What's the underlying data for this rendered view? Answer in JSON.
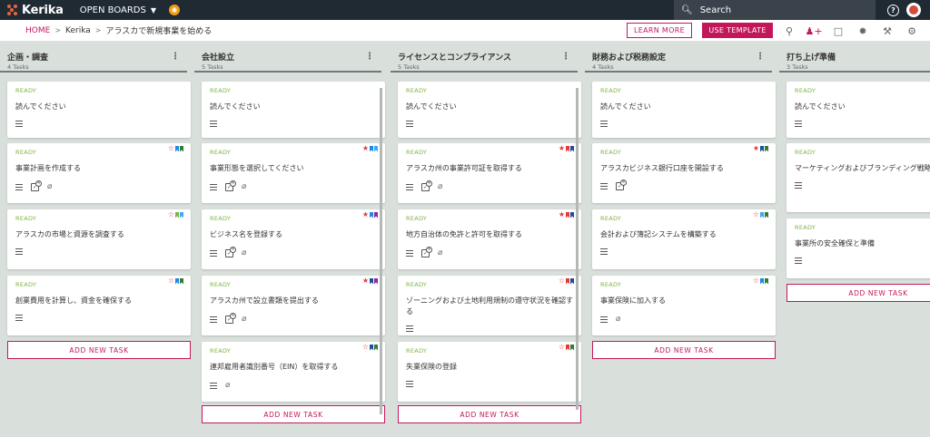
{
  "topbar": {
    "app_name": "Kerika",
    "open_boards": "OPEN BOARDS",
    "search_placeholder": "Search"
  },
  "breadcrumb": {
    "home": "HOME",
    "account": "Kerika",
    "board": "アラスカで新規事業を始める"
  },
  "actions": {
    "learn_more": "LEARN MORE",
    "use_template": "USE TEMPLATE"
  },
  "colors": {
    "accent": "#c2185b",
    "ready": "#7cb342",
    "flag_blue": "#1e88e5",
    "flag_navy": "#1a4fa0",
    "flag_green": "#2e7d32",
    "flag_purple": "#8e24aa",
    "flag_red": "#e53935",
    "flag_lightblue": "#42a5f5",
    "flag_lime": "#7cb342"
  },
  "columns": [
    {
      "title": "企画・調査",
      "count": "4 Tasks",
      "add_task": "ADD NEW TASK",
      "cards": [
        {
          "status": "READY",
          "title": "読んでください",
          "icons": [
            "lines"
          ],
          "markers": []
        },
        {
          "status": "READY",
          "title": "事業計画を作成する",
          "icons": [
            "lines",
            "check",
            "clip"
          ],
          "check_num": "4",
          "markers": [
            "star-outline",
            "flag_blue",
            "flag_green"
          ]
        },
        {
          "status": "READY",
          "title": "アラスカの市場と資源を調査する",
          "icons": [
            "lines"
          ],
          "markers": [
            "star-outline",
            "flag_lime",
            "flag_lightblue"
          ]
        },
        {
          "status": "READY",
          "title": "創業費用を計算し、資金を確保する",
          "icons": [
            "lines"
          ],
          "markers": [
            "star-outline",
            "flag_blue",
            "flag_green"
          ]
        }
      ]
    },
    {
      "title": "会社設立",
      "count": "5 Tasks",
      "add_task": "ADD NEW TASK",
      "cards": [
        {
          "status": "READY",
          "title": "読んでください",
          "icons": [
            "lines"
          ],
          "markers": []
        },
        {
          "status": "READY",
          "title": "事業形態を選択してください",
          "icons": [
            "lines",
            "check",
            "clip"
          ],
          "check_num": "4",
          "markers": [
            "star",
            "flag_blue",
            "flag_lightblue"
          ]
        },
        {
          "status": "READY",
          "title": "ビジネス名を登録する",
          "icons": [
            "lines",
            "check",
            "clip"
          ],
          "check_num": "4",
          "markers": [
            "star",
            "flag_blue",
            "flag_purple"
          ]
        },
        {
          "status": "READY",
          "title": "アラスカ州で設立書類を提出する",
          "icons": [
            "lines",
            "check",
            "clip"
          ],
          "check_num": "4",
          "markers": [
            "star",
            "flag_navy",
            "flag_purple"
          ]
        },
        {
          "status": "READY",
          "title": "連邦雇用者識別番号（EIN）を取得する",
          "icons": [
            "lines",
            "clip"
          ],
          "markers": [
            "star-outline",
            "flag_navy",
            "flag_green"
          ]
        }
      ]
    },
    {
      "title": "ライセンスとコンプライアンス",
      "count": "5 Tasks",
      "add_task": "ADD NEW TASK",
      "cards": [
        {
          "status": "READY",
          "title": "読んでください",
          "icons": [
            "lines"
          ],
          "markers": []
        },
        {
          "status": "READY",
          "title": "アラスカ州の事業許可証を取得する",
          "icons": [
            "lines",
            "check",
            "clip"
          ],
          "check_num": "4",
          "markers": [
            "star",
            "flag_red",
            "flag_navy"
          ]
        },
        {
          "status": "READY",
          "title": "地方自治体の免許と許可を取得する",
          "icons": [
            "lines",
            "check",
            "clip"
          ],
          "check_num": "4",
          "markers": [
            "star",
            "flag_red",
            "flag_navy"
          ]
        },
        {
          "status": "READY",
          "title": "ゾーニングおよび土地利用規制の遵守状況を確認する",
          "icons": [
            "lines"
          ],
          "markers": [
            "star-outline",
            "flag_red",
            "flag_navy"
          ]
        },
        {
          "status": "READY",
          "title": "失業保険の登録",
          "icons": [
            "lines"
          ],
          "markers": [
            "star-outline",
            "flag_red",
            "flag_green"
          ]
        }
      ]
    },
    {
      "title": "財務および税務設定",
      "count": "4 Tasks",
      "add_task": "ADD NEW TASK",
      "cards": [
        {
          "status": "READY",
          "title": "読んでください",
          "icons": [
            "lines"
          ],
          "markers": []
        },
        {
          "status": "READY",
          "title": "アラスカビジネス銀行口座を開設する",
          "icons": [
            "lines",
            "check"
          ],
          "check_num": "4",
          "markers": [
            "star",
            "flag_navy",
            "flag_green"
          ]
        },
        {
          "status": "READY",
          "title": "会計および簿記システムを構築する",
          "icons": [
            "lines"
          ],
          "markers": [
            "star-outline",
            "flag_lightblue",
            "flag_green"
          ]
        },
        {
          "status": "READY",
          "title": "事業保険に加入する",
          "icons": [
            "lines",
            "clip"
          ],
          "markers": [
            "star-outline",
            "flag_blue",
            "flag_green"
          ]
        }
      ]
    },
    {
      "title": "打ち上げ準備",
      "count": "3 Tasks",
      "add_task": "ADD NEW TASK",
      "cards": [
        {
          "status": "READY",
          "title": "読んでください",
          "icons": [
            "lines"
          ],
          "markers": []
        },
        {
          "status": "READY",
          "title": "マーケティングおよびブランディング戦略",
          "icons": [
            "lines"
          ],
          "markers": []
        },
        {
          "status": "READY",
          "title": "事業所の安全確保と準備",
          "icons": [
            "lines"
          ],
          "markers": []
        }
      ]
    }
  ]
}
